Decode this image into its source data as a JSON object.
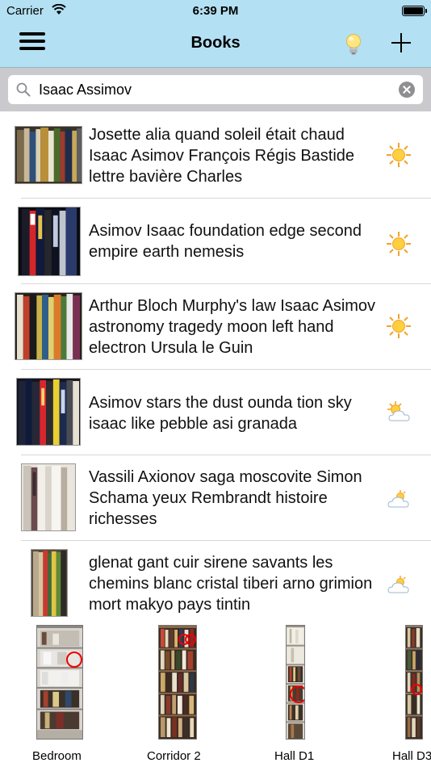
{
  "status": {
    "carrier": "Carrier",
    "time": "6:39 PM"
  },
  "nav": {
    "title": "Books"
  },
  "search": {
    "value": "Isaac Assimov"
  },
  "rows": [
    {
      "text": "Josette alia quand soleil était chaud Isaac Asimov François Régis Bastide lettre bavière Charles",
      "weather": "sun-icon"
    },
    {
      "text": "Asimov Isaac foundation edge second empire earth nemesis",
      "weather": "sun-icon"
    },
    {
      "text": "Arthur Bloch Murphy's law Isaac Asimov astronomy tragedy moon left hand electron Ursula le Guin",
      "weather": "sun-icon"
    },
    {
      "text": "Asimov stars the dust ounda tion sky isaac like pebble asi granada",
      "weather": "partly-cloudy-icon"
    },
    {
      "text": "Vassili Axionov saga moscovite Simon Schama yeux Rembrandt histoire richesses",
      "weather": "cloud-icon"
    },
    {
      "text": "glenat gant cuir sirene savants les chemins blanc cristal tiberi arno grimion mort makyo pays tintin",
      "weather": "partly-cloudy-icon"
    }
  ],
  "shelves": [
    {
      "label": "Bedroom"
    },
    {
      "label": "Corridor 2"
    },
    {
      "label": "Hall D1"
    },
    {
      "label": "Hall D3"
    }
  ],
  "colors": {
    "nav_bar": "#b3e0f2",
    "search_bar": "#c9c9ce",
    "marker": "#e00000"
  }
}
